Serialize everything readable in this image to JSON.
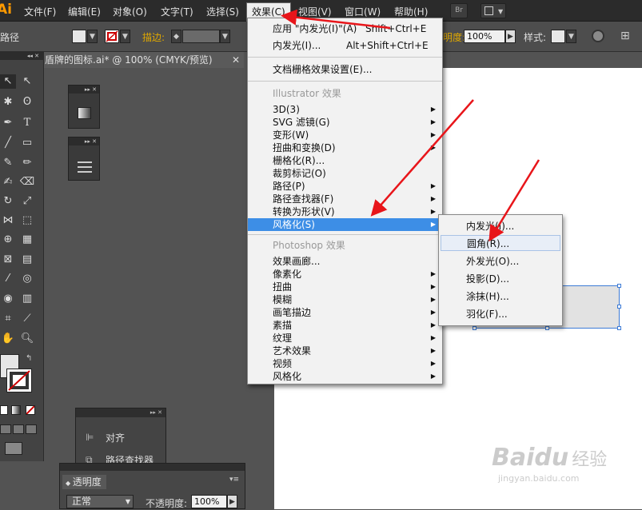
{
  "app": {
    "logo": "Ai"
  },
  "menubar": {
    "items": [
      "文件(F)",
      "编辑(E)",
      "对象(O)",
      "文字(T)",
      "选择(S)",
      "效果(C)",
      "视图(V)",
      "窗口(W)",
      "帮助(H)"
    ],
    "right_btn": "Br"
  },
  "control_bar": {
    "left_label": "路径",
    "stroke_label": "描边:",
    "opacity_label": "明度:",
    "opacity_value": "100%",
    "style_label": "样式:"
  },
  "document": {
    "tab_title": "盾牌的图标.ai* @ 100% (CMYK/预览)"
  },
  "effect_menu": {
    "apply_last": "应用 \"内发光(I)\"(A)",
    "apply_last_shortcut": "Shift+Ctrl+E",
    "last_effect": "内发光(I)...",
    "last_effect_shortcut": "Alt+Shift+Ctrl+E",
    "raster_settings": "文档栅格效果设置(E)...",
    "illustrator_header": "Illustrator 效果",
    "illustrator_items": [
      "3D(3)",
      "SVG 滤镜(G)",
      "变形(W)",
      "扭曲和变换(D)",
      "栅格化(R)...",
      "裁剪标记(O)",
      "路径(P)",
      "路径查找器(F)",
      "转换为形状(V)",
      "风格化(S)"
    ],
    "photoshop_header": "Photoshop 效果",
    "photoshop_items": [
      "效果画廊...",
      "像素化",
      "扭曲",
      "模糊",
      "画笔描边",
      "素描",
      "纹理",
      "艺术效果",
      "视频",
      "风格化"
    ]
  },
  "stylize_submenu": {
    "items": [
      "内发光(I)...",
      "圆角(R)...",
      "外发光(O)...",
      "投影(D)...",
      "涂抹(H)...",
      "羽化(F)..."
    ]
  },
  "panels": {
    "align_label": "对齐",
    "pathfinder_label": "路径查找器",
    "transparency_tab": "透明度",
    "blend_mode": "正常",
    "opacity_label": "不透明度:",
    "opacity_value": "100%"
  },
  "watermark": {
    "brand": "Baidu",
    "brand_cn": "经验",
    "url": "jingyan.baidu.com"
  },
  "colors": {
    "highlight": "#3d8ee6",
    "arrow": "#e8151a",
    "logo": "#ff9a00"
  }
}
